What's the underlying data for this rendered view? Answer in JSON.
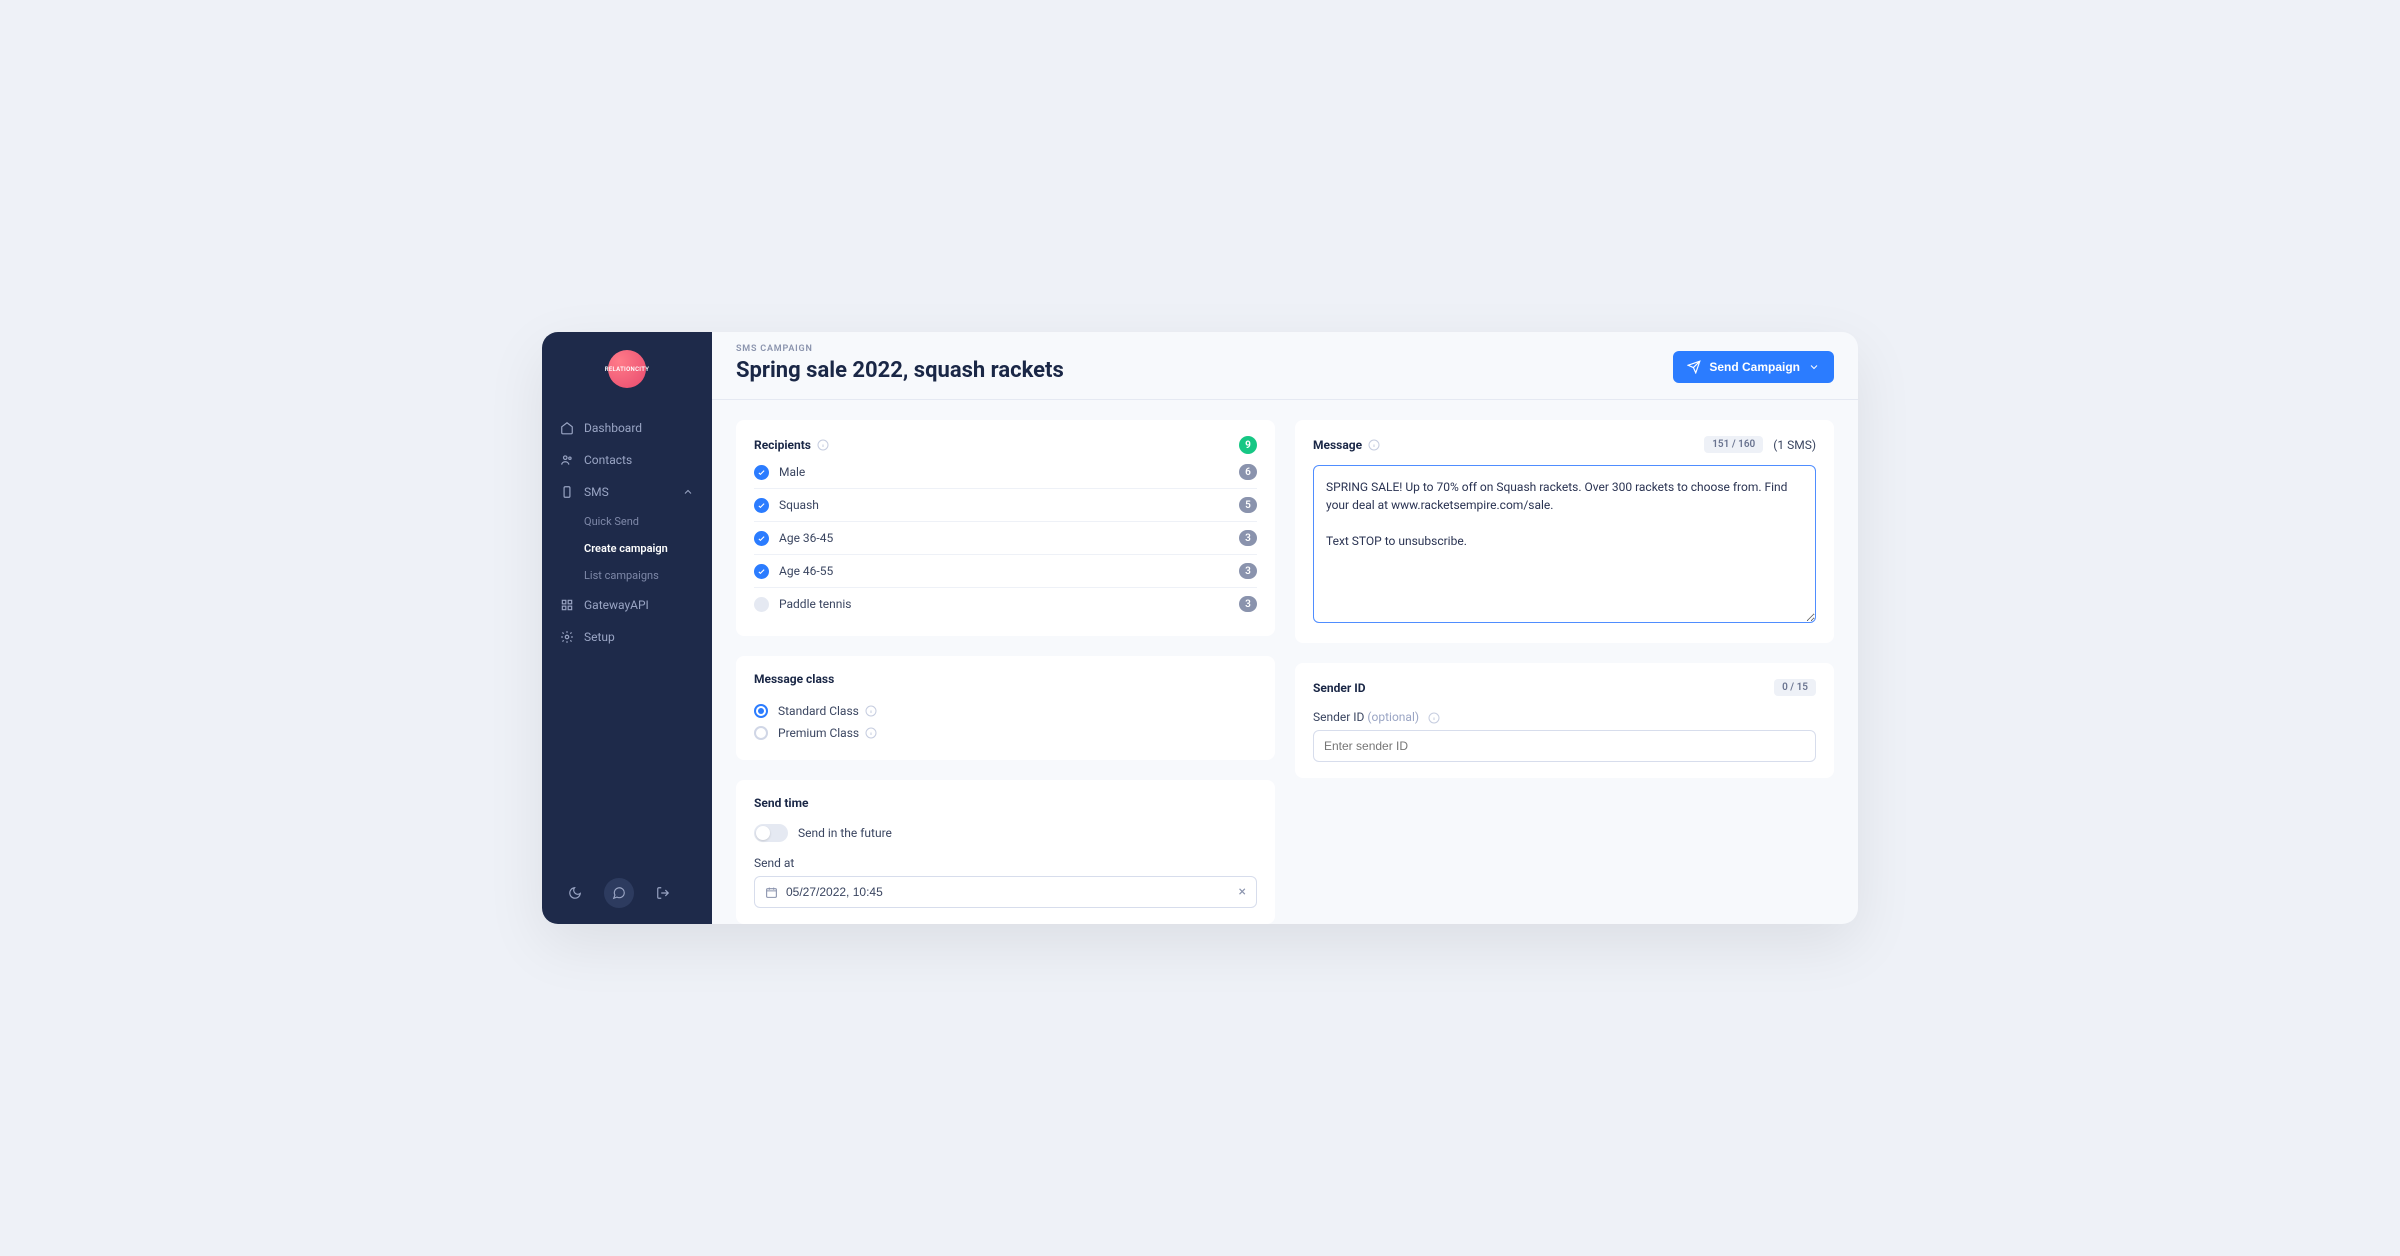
{
  "brand": "RELATIONCITY",
  "nav": {
    "dashboard": "Dashboard",
    "contacts": "Contacts",
    "sms": "SMS",
    "quick_send": "Quick Send",
    "create_campaign": "Create campaign",
    "list_campaigns": "List campaigns",
    "gatewayapi": "GatewayAPI",
    "setup": "Setup"
  },
  "header": {
    "crumb": "SMS CAMPAIGN",
    "title": "Spring sale 2022, squash rackets",
    "send_button": "Send Campaign"
  },
  "recipients": {
    "title": "Recipients",
    "total": "9",
    "rows": [
      {
        "label": "Male",
        "count": "6",
        "checked": true
      },
      {
        "label": "Squash",
        "count": "5",
        "checked": true
      },
      {
        "label": "Age 36-45",
        "count": "3",
        "checked": true
      },
      {
        "label": "Age 46-55",
        "count": "3",
        "checked": true
      },
      {
        "label": "Paddle tennis",
        "count": "3",
        "checked": false
      }
    ]
  },
  "message_class": {
    "title": "Message class",
    "standard": "Standard Class",
    "premium": "Premium Class"
  },
  "send_time": {
    "title": "Send time",
    "toggle_label": "Send in the future",
    "send_at_label": "Send at",
    "send_at_value": "05/27/2022, 10:45"
  },
  "message": {
    "title": "Message",
    "counter": "151 / 160",
    "sms_count": "(1 SMS)",
    "text": "SPRING SALE! Up to 70% off on Squash rackets. Over 300 rackets to choose from. Find your deal at www.racketsempire.com/sale.\n\nText STOP to unsubscribe."
  },
  "sender": {
    "title": "Sender ID",
    "counter": "0 / 15",
    "field_label": "Sender ID",
    "optional": "(optional)",
    "placeholder": "Enter sender ID"
  }
}
